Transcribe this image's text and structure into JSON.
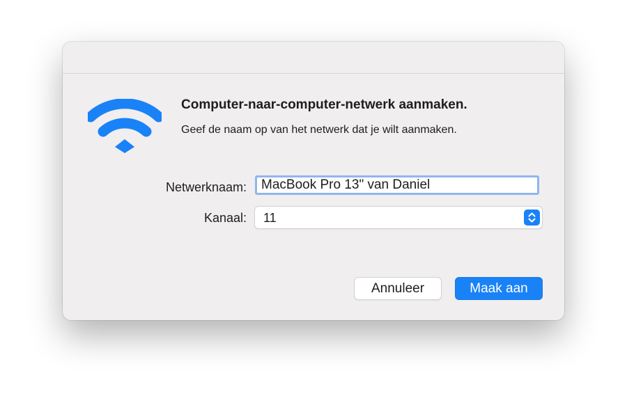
{
  "dialog": {
    "heading": "Computer-naar-computer-netwerk aanmaken.",
    "subtext": "Geef de naam op van het netwerk dat je wilt aanmaken.",
    "icon": "wifi-icon",
    "accent_color": "#1a82f7"
  },
  "form": {
    "network_name_label": "Netwerknaam:",
    "network_name_value": "MacBook Pro 13\" van Daniel",
    "channel_label": "Kanaal:",
    "channel_value": "11"
  },
  "buttons": {
    "cancel_label": "Annuleer",
    "create_label": "Maak aan"
  }
}
